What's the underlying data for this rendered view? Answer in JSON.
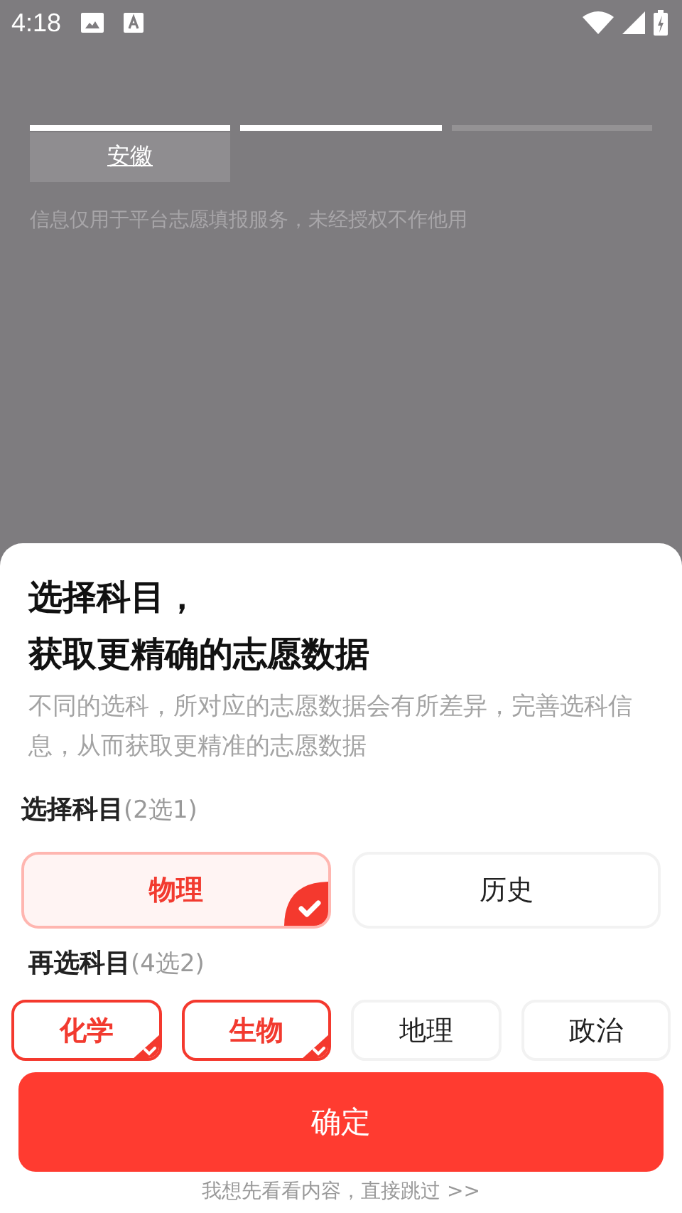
{
  "status_bar": {
    "time": "4:18"
  },
  "steps": [
    {
      "done": true
    },
    {
      "done": true
    },
    {
      "done": false
    }
  ],
  "province": "安徽",
  "notice": "信息仅用于平台志愿填报服务，未经授权不作他用",
  "sheet": {
    "title_lines": [
      "选择科目，",
      "获取更精确的志愿数据"
    ],
    "description": "不同的选科，所对应的志愿数据会有所差异，完善选科信息，从而获取更精准的志愿数据",
    "groups": [
      {
        "label": "选择科目",
        "hint": "(2选1)",
        "kind": "large",
        "options": [
          {
            "label": "物理",
            "selected": true
          },
          {
            "label": "历史",
            "selected": false
          }
        ]
      },
      {
        "label": "再选科目",
        "hint": "(4选2)",
        "kind": "small",
        "options": [
          {
            "label": "化学",
            "selected": true
          },
          {
            "label": "生物",
            "selected": true
          },
          {
            "label": "地理",
            "selected": false
          },
          {
            "label": "政治",
            "selected": false
          }
        ]
      }
    ],
    "confirm_button": "确定",
    "skip_link": "我想先看看内容，直接跳过 >>"
  }
}
